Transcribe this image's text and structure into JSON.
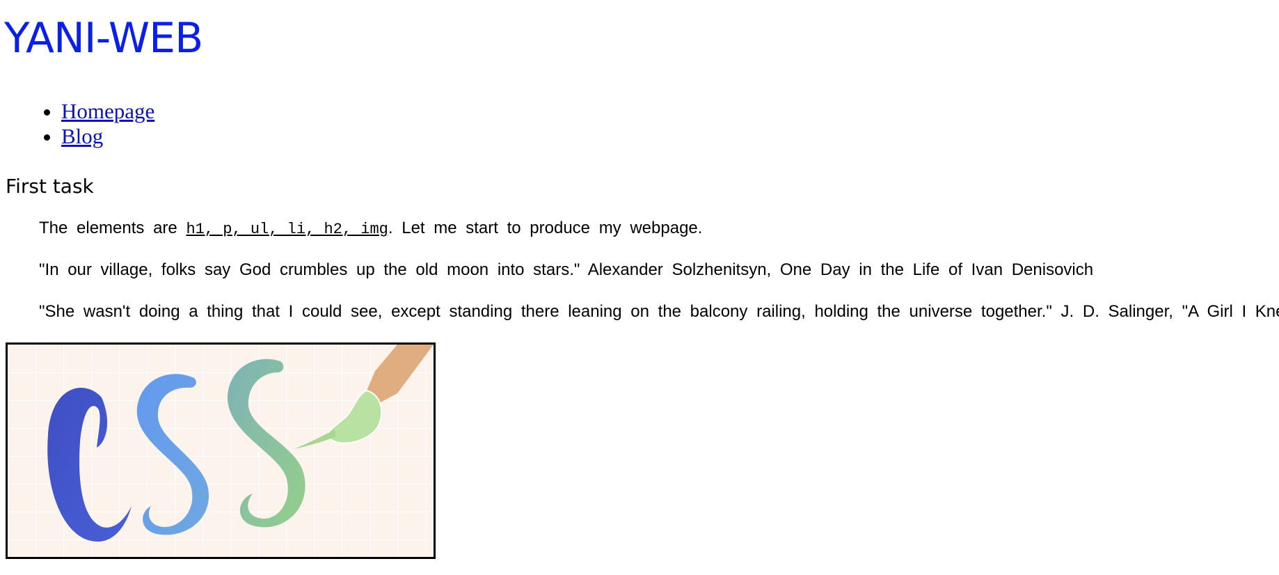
{
  "header": {
    "site_title": "YANI-WEB"
  },
  "nav": {
    "items": [
      {
        "label": "Homepage"
      },
      {
        "label": "Blog"
      }
    ]
  },
  "main": {
    "section_heading": "First task",
    "paragraph1": {
      "before": "The elements are ",
      "code": "h1, p, ul, li, h2, img",
      "after": ". Let me start to produce my webpage."
    },
    "quote1": "\"In our village, folks say God crumbles up the old moon into stars.\" Alexander Solzhenitsyn, One Day in the Life of Ivan Denisovich",
    "quote2": "\"She wasn't doing a thing that I could see, except standing there leaning on the balcony railing, holding the universe together.\" J. D. Salinger, \"A Girl I Knew\""
  },
  "image": {
    "lettering": "CSS",
    "description_icon": "css-paintbrush-logo",
    "colors": {
      "background": "#fbf3ec",
      "c_letter": "#4050c8",
      "s1_letter": "#5f97ee",
      "s2_letter": "#86c28a",
      "brush_handle": "#e0ad80",
      "brush_tip": "#b7e0a0"
    }
  }
}
